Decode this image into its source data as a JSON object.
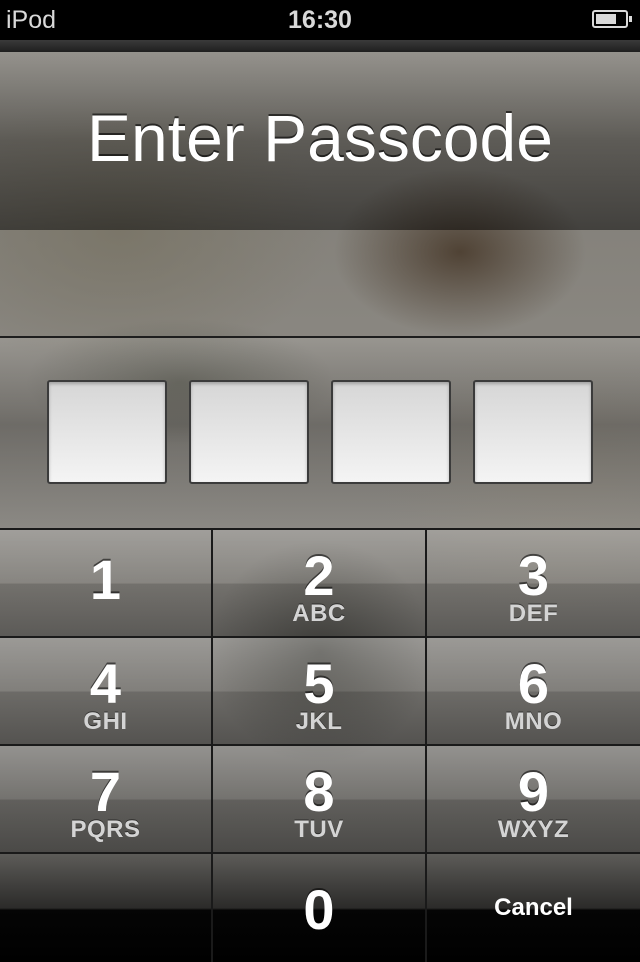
{
  "status_bar": {
    "carrier": "iPod",
    "time": "16:30",
    "battery_icon": "battery-icon"
  },
  "header": {
    "title": "Enter Passcode"
  },
  "passcode": {
    "digit_count": 4,
    "entered": [
      "",
      "",
      "",
      ""
    ]
  },
  "keypad": {
    "keys": [
      {
        "number": "1",
        "letters": ""
      },
      {
        "number": "2",
        "letters": "ABC"
      },
      {
        "number": "3",
        "letters": "DEF"
      },
      {
        "number": "4",
        "letters": "GHI"
      },
      {
        "number": "5",
        "letters": "JKL"
      },
      {
        "number": "6",
        "letters": "MNO"
      },
      {
        "number": "7",
        "letters": "PQRS"
      },
      {
        "number": "8",
        "letters": "TUV"
      },
      {
        "number": "9",
        "letters": "WXYZ"
      },
      {
        "number": "0",
        "letters": ""
      }
    ],
    "cancel_label": "Cancel"
  },
  "colors": {
    "text": "#ffffff",
    "subtext": "#d4d4d4",
    "separator": "#1a1a1a",
    "status_bar_bg": "#000000"
  }
}
